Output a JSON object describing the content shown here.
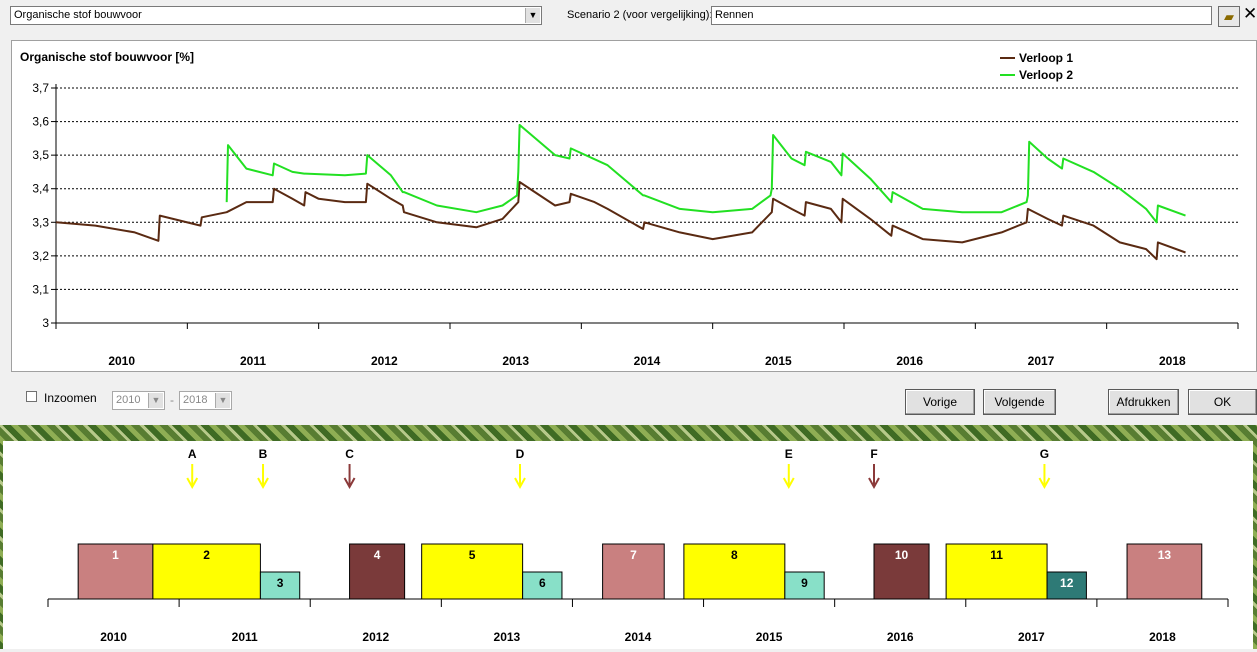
{
  "toolbar": {
    "variable_select": "Organische stof bouwvoor",
    "scenario_label": "Scenario 2 (voor vergelijking):",
    "scenario_value": "Rennen",
    "open_icon": "folder-open-icon",
    "close_icon": "close-icon"
  },
  "chart_data": {
    "type": "line",
    "title": "Organische stof bouwvoor [%]",
    "ylim": [
      3.0,
      3.7
    ],
    "yticks": [
      "3",
      "3,1",
      "3,2",
      "3,3",
      "3,4",
      "3,5",
      "3,6",
      "3,7"
    ],
    "xlim": [
      2010,
      2019
    ],
    "x_labels": [
      "2010",
      "2011",
      "2012",
      "2013",
      "2014",
      "2015",
      "2016",
      "2017",
      "2018"
    ],
    "grid": true,
    "legend_position": "top-right",
    "colors": {
      "Verloop 1": "#5a2a12",
      "Verloop 2": "#22e022"
    },
    "series": [
      {
        "name": "Verloop 1",
        "x": [
          2010.0,
          2010.3,
          2010.6,
          2010.78,
          2010.79,
          2011.1,
          2011.11,
          2011.3,
          2011.45,
          2011.65,
          2011.66,
          2011.8,
          2011.89,
          2011.9,
          2012.0,
          2012.2,
          2012.36,
          2012.37,
          2012.55,
          2012.64,
          2012.65,
          2012.9,
          2013.2,
          2013.4,
          2013.52,
          2013.53,
          2013.8,
          2013.91,
          2013.92,
          2014.1,
          2014.2,
          2014.47,
          2014.48,
          2014.75,
          2015.0,
          2015.3,
          2015.45,
          2015.46,
          2015.6,
          2015.7,
          2015.71,
          2015.9,
          2015.98,
          2015.99,
          2016.2,
          2016.36,
          2016.37,
          2016.6,
          2016.9,
          2017.2,
          2017.39,
          2017.4,
          2017.55,
          2017.66,
          2017.67,
          2017.9,
          2018.1,
          2018.3,
          2018.38,
          2018.39,
          2018.6
        ],
        "y": [
          3.3,
          3.29,
          3.27,
          3.245,
          3.32,
          3.29,
          3.315,
          3.33,
          3.36,
          3.36,
          3.4,
          3.37,
          3.35,
          3.39,
          3.37,
          3.36,
          3.36,
          3.415,
          3.37,
          3.35,
          3.33,
          3.3,
          3.285,
          3.31,
          3.36,
          3.42,
          3.35,
          3.36,
          3.385,
          3.36,
          3.34,
          3.28,
          3.3,
          3.27,
          3.25,
          3.27,
          3.33,
          3.37,
          3.34,
          3.32,
          3.36,
          3.34,
          3.3,
          3.37,
          3.31,
          3.26,
          3.29,
          3.25,
          3.24,
          3.27,
          3.3,
          3.34,
          3.31,
          3.29,
          3.32,
          3.29,
          3.24,
          3.22,
          3.19,
          3.24,
          3.21
        ]
      },
      {
        "name": "Verloop 2",
        "x": [
          2011.3,
          2011.31,
          2011.45,
          2011.65,
          2011.66,
          2011.8,
          2011.89,
          2011.9,
          2012.2,
          2012.36,
          2012.37,
          2012.55,
          2012.64,
          2012.65,
          2012.9,
          2013.2,
          2013.4,
          2013.51,
          2013.52,
          2013.53,
          2013.8,
          2013.91,
          2013.92,
          2014.2,
          2014.47,
          2014.48,
          2014.75,
          2015.0,
          2015.3,
          2015.44,
          2015.45,
          2015.46,
          2015.6,
          2015.7,
          2015.71,
          2015.9,
          2015.98,
          2015.99,
          2016.2,
          2016.36,
          2016.37,
          2016.6,
          2016.9,
          2017.2,
          2017.39,
          2017.4,
          2017.41,
          2017.55,
          2017.66,
          2017.67,
          2017.9,
          2018.1,
          2018.3,
          2018.38,
          2018.39,
          2018.6
        ],
        "y": [
          3.36,
          3.53,
          3.46,
          3.44,
          3.475,
          3.45,
          3.445,
          3.445,
          3.44,
          3.445,
          3.5,
          3.44,
          3.39,
          3.39,
          3.35,
          3.33,
          3.35,
          3.38,
          3.45,
          3.59,
          3.5,
          3.49,
          3.52,
          3.47,
          3.38,
          3.38,
          3.34,
          3.33,
          3.34,
          3.38,
          3.4,
          3.56,
          3.49,
          3.47,
          3.51,
          3.48,
          3.44,
          3.505,
          3.43,
          3.36,
          3.39,
          3.34,
          3.33,
          3.33,
          3.36,
          3.38,
          3.54,
          3.49,
          3.46,
          3.49,
          3.45,
          3.4,
          3.34,
          3.3,
          3.35,
          3.32
        ]
      }
    ]
  },
  "controls": {
    "zoom_label": "Inzoomen",
    "year_from": "2010",
    "year_sep": "-",
    "year_to": "2018",
    "prev_label": "Vorige",
    "next_label": "Volgende",
    "print_label": "Afdrukken",
    "ok_label": "OK"
  },
  "timeline": {
    "years": [
      "2010",
      "2011",
      "2012",
      "2013",
      "2014",
      "2015",
      "2016",
      "2017",
      "2018"
    ],
    "events": [
      {
        "letter": "A",
        "year": 2011.1,
        "color": "#ffff00"
      },
      {
        "letter": "B",
        "year": 2011.64,
        "color": "#ffff00"
      },
      {
        "letter": "C",
        "year": 2012.3,
        "color": "#8b3a3a"
      },
      {
        "letter": "D",
        "year": 2013.6,
        "color": "#ffff00"
      },
      {
        "letter": "E",
        "year": 2015.65,
        "color": "#ffff00"
      },
      {
        "letter": "F",
        "year": 2016.3,
        "color": "#8b3a3a"
      },
      {
        "letter": "G",
        "year": 2017.6,
        "color": "#ffff00"
      }
    ],
    "blocks": [
      {
        "label": "1",
        "start": 2010.23,
        "end": 2010.8,
        "level": "high",
        "color": "#c98080",
        "text_color": "#ffffff"
      },
      {
        "label": "2",
        "start": 2010.8,
        "end": 2011.62,
        "level": "high",
        "color": "#ffff00",
        "text_color": "#000000"
      },
      {
        "label": "3",
        "start": 2011.62,
        "end": 2011.92,
        "level": "low",
        "color": "#88e0c8",
        "text_color": "#000000"
      },
      {
        "label": "4",
        "start": 2012.3,
        "end": 2012.72,
        "level": "high",
        "color": "#7a3a3a",
        "text_color": "#ffffff"
      },
      {
        "label": "5",
        "start": 2012.85,
        "end": 2013.62,
        "level": "high",
        "color": "#ffff00",
        "text_color": "#000000"
      },
      {
        "label": "6",
        "start": 2013.62,
        "end": 2013.92,
        "level": "low",
        "color": "#88e0c8",
        "text_color": "#000000"
      },
      {
        "label": "7",
        "start": 2014.23,
        "end": 2014.7,
        "level": "high",
        "color": "#c98080",
        "text_color": "#ffffff"
      },
      {
        "label": "8",
        "start": 2014.85,
        "end": 2015.62,
        "level": "high",
        "color": "#ffff00",
        "text_color": "#000000"
      },
      {
        "label": "9",
        "start": 2015.62,
        "end": 2015.92,
        "level": "low",
        "color": "#88e0c8",
        "text_color": "#000000"
      },
      {
        "label": "10",
        "start": 2016.3,
        "end": 2016.72,
        "level": "high",
        "color": "#7a3a3a",
        "text_color": "#ffffff"
      },
      {
        "label": "11",
        "start": 2016.85,
        "end": 2017.62,
        "level": "high",
        "color": "#ffff00",
        "text_color": "#000000"
      },
      {
        "label": "12",
        "start": 2017.62,
        "end": 2017.92,
        "level": "low",
        "color": "#2e7a76",
        "text_color": "#ffffff"
      },
      {
        "label": "13",
        "start": 2018.23,
        "end": 2018.8,
        "level": "high",
        "color": "#c98080",
        "text_color": "#ffffff"
      }
    ]
  }
}
